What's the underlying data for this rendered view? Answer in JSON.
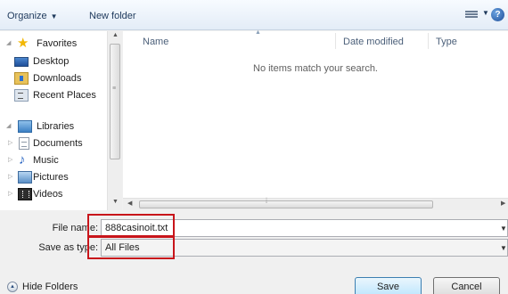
{
  "toolbar": {
    "organize_label": "Organize",
    "new_folder_label": "New folder",
    "help_label": "?"
  },
  "nav": {
    "favorites": {
      "label": "Favorites",
      "items": [
        {
          "label": "Desktop",
          "icon": "desktop-icon"
        },
        {
          "label": "Downloads",
          "icon": "downloads-folder-icon"
        },
        {
          "label": "Recent Places",
          "icon": "recent-places-icon"
        }
      ]
    },
    "libraries": {
      "label": "Libraries",
      "items": [
        {
          "label": "Documents",
          "icon": "documents-icon"
        },
        {
          "label": "Music",
          "icon": "music-icon"
        },
        {
          "label": "Pictures",
          "icon": "pictures-icon"
        },
        {
          "label": "Videos",
          "icon": "videos-icon"
        }
      ]
    }
  },
  "filelist": {
    "columns": [
      "Name",
      "Date modified",
      "Type"
    ],
    "empty_message": "No items match your search."
  },
  "form": {
    "file_name_label": "File name:",
    "file_name_value": "888casinoit.txt",
    "save_as_type_label": "Save as type:",
    "save_as_type_value": "All Files"
  },
  "footer": {
    "hide_folders_label": "Hide Folders",
    "save_label": "Save",
    "cancel_label": "Cancel"
  },
  "colors": {
    "highlight": "#c8151b",
    "toolbar_text": "#1e395b"
  }
}
